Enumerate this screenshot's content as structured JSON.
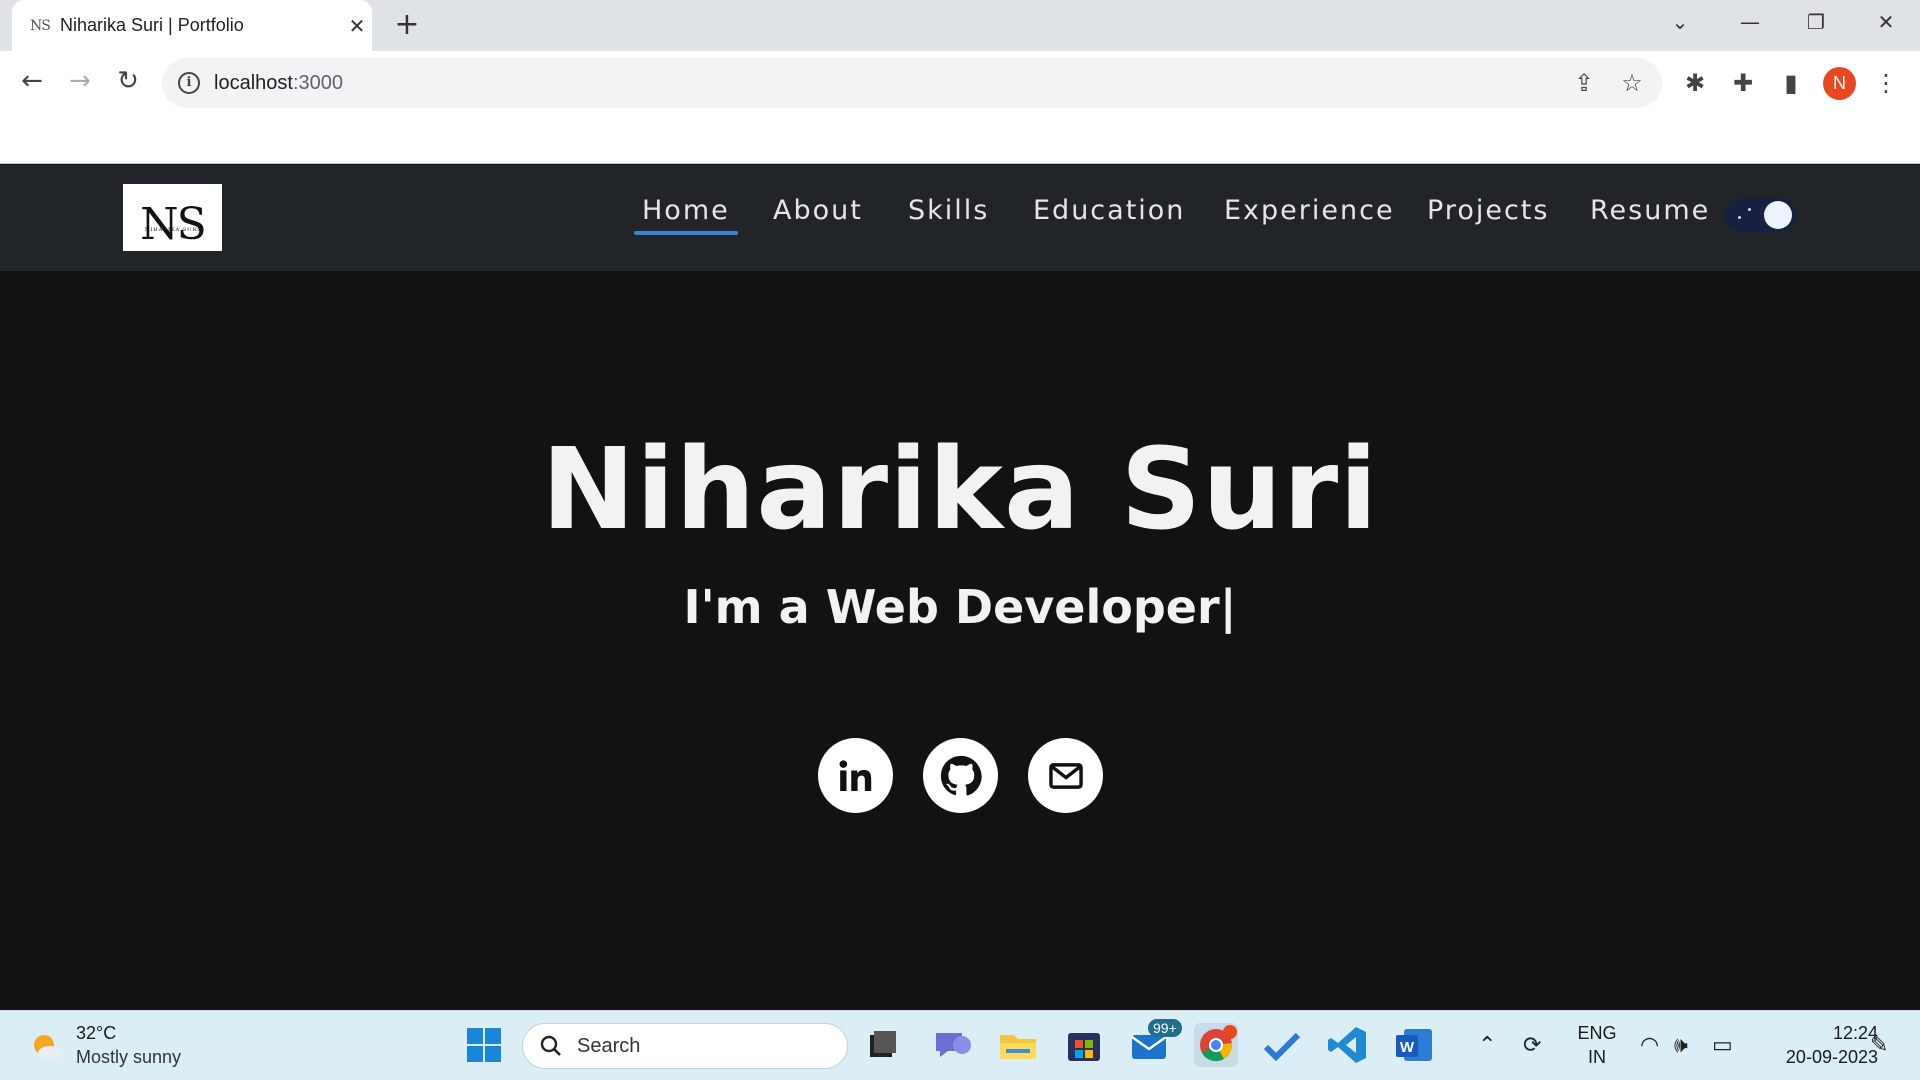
{
  "browser": {
    "tab_title": "Niharika Suri | Portfolio",
    "tab_favicon_text": "NS",
    "url_host": "localhost",
    "url_port": ":3000",
    "profile_initial": "N"
  },
  "site": {
    "logo_monogram": "NS",
    "logo_subtitle": "NIHARIKA SURI",
    "nav": [
      {
        "label": "Home",
        "active": true
      },
      {
        "label": "About"
      },
      {
        "label": "Skills"
      },
      {
        "label": "Education"
      },
      {
        "label": "Experience"
      },
      {
        "label": "Projects"
      },
      {
        "label": "Resume"
      }
    ],
    "theme_toggle": "dark",
    "accent_color": "#3b82d6"
  },
  "hero": {
    "name": "Niharika Suri",
    "tagline_prefix": "I'm a ",
    "tagline_role": "Web Developer",
    "cursor": "|",
    "social": [
      {
        "icon": "linkedin-icon"
      },
      {
        "icon": "github-icon"
      },
      {
        "icon": "mail-icon"
      }
    ]
  },
  "taskbar": {
    "weather_temp": "32°C",
    "weather_desc": "Mostly sunny",
    "search_label": "Search",
    "mail_badge": "99+",
    "lang_line1": "ENG",
    "lang_line2": "IN",
    "time": "12:24",
    "date": "20-09-2023"
  }
}
